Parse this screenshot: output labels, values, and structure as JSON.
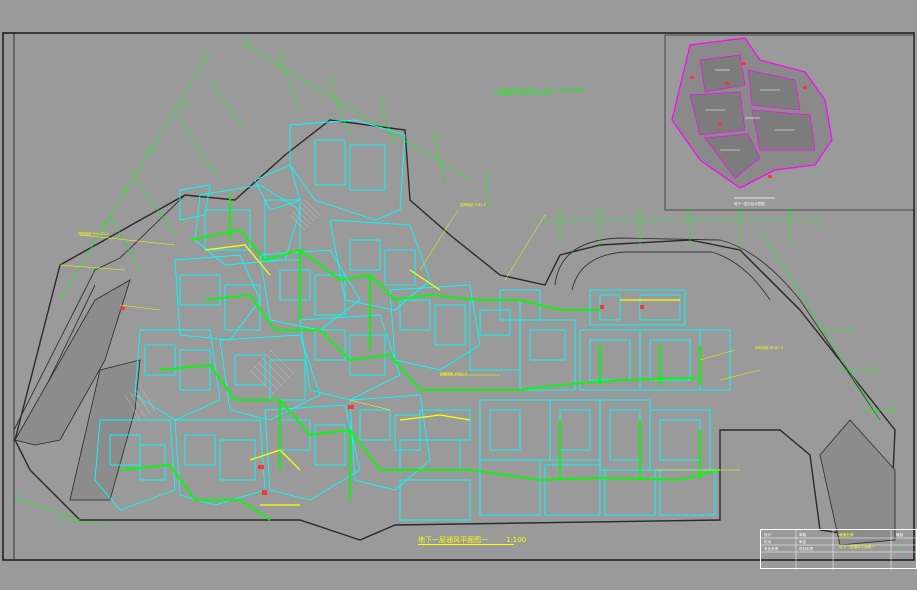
{
  "drawing": {
    "plan_title": "地下一层通风平面图一",
    "plan_scale": "1:100",
    "background_color": "#9a9a9a",
    "colors": {
      "walls": "#00ffff",
      "ducts": "#00ff00",
      "ducts_alt": "#ffff00",
      "grid": "#00ff00",
      "frame": "#1a1a1a",
      "keyplan_outline": "#ff00ff",
      "keyplan_fill": "#8a8a8a",
      "highlight": "#ff3333"
    }
  },
  "legend_notes": [
    "1.本图所注风管尺寸均为宽×高，单位mm，标高以风管底计。",
    "2.风管穿越防火分区处设70℃防火阀。"
  ],
  "duct_labels": [
    "排风系统 P(Y)-B1-1",
    "送风系统 S-B1-2",
    "排烟风机 PY-B1-3",
    "补风系统 BF-B1-4"
  ],
  "title_block": {
    "rows": [
      [
        "设计",
        "",
        "审核",
        ""
      ],
      [
        "校对",
        "",
        "审定",
        ""
      ],
      [
        "专业负责",
        "",
        "项目负责",
        ""
      ]
    ],
    "project": "暖通空调",
    "drawing_no": "暖施",
    "sheet": "14"
  },
  "key_plan": {
    "caption": "地下一层分区示意图"
  },
  "icons": {
    "north_marker": "grid-axis-bubble-icon"
  }
}
